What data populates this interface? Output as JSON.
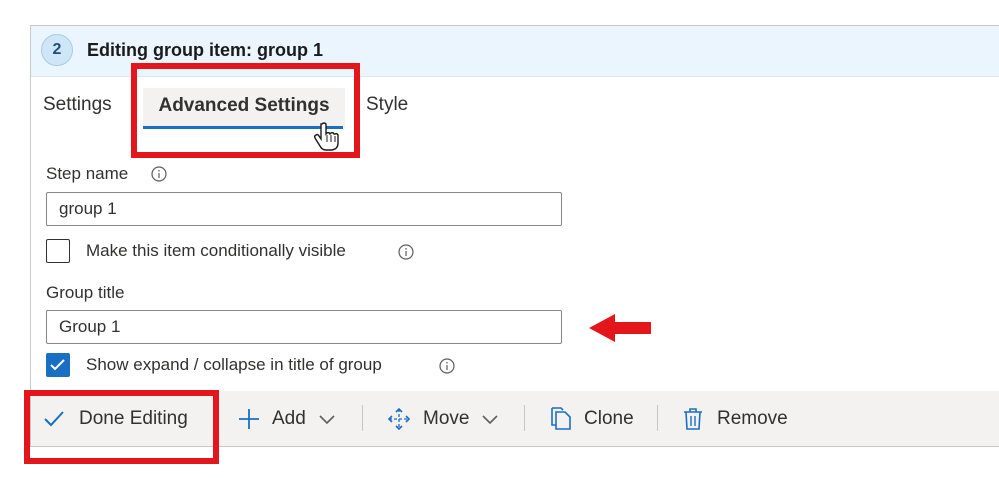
{
  "header": {
    "step_number": "2",
    "title": "Editing group item: group 1"
  },
  "tabs": [
    {
      "label": "Settings",
      "active": false
    },
    {
      "label": "Advanced Settings",
      "active": true
    },
    {
      "label": "Style",
      "active": false
    }
  ],
  "form": {
    "step_name_label": "Step name",
    "step_name_value": "group 1",
    "conditional_label": "Make this item conditionally visible",
    "conditional_checked": false,
    "group_title_label": "Group title",
    "group_title_value": "Group 1",
    "expand_label": "Show expand / collapse in title of group",
    "expand_checked": true
  },
  "toolbar": {
    "done_label": "Done Editing",
    "add_label": "Add",
    "move_label": "Move",
    "clone_label": "Clone",
    "remove_label": "Remove"
  },
  "colors": {
    "accent": "#1a6fc4",
    "highlight": "#e3161b",
    "header_bg": "#eaf5fd"
  },
  "icons": [
    "info-icon",
    "checkmark-icon",
    "plus-icon",
    "chevron-down-icon",
    "move-arrows-icon",
    "clone-icon",
    "trash-icon",
    "hand-pointer-cursor-icon",
    "left-arrow-icon"
  ]
}
